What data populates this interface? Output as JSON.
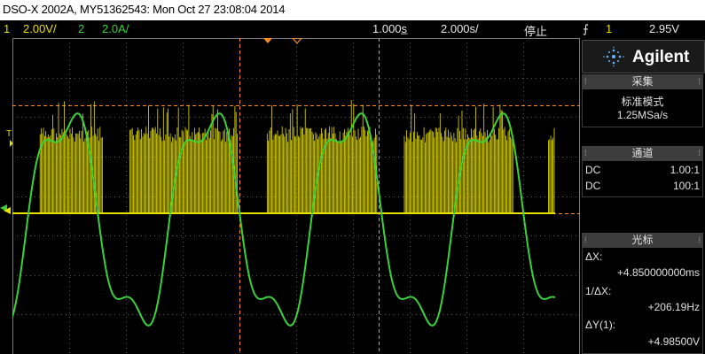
{
  "title_bar": {
    "text": "DSO-X 2002A, MY51362543: Mon Oct 27 23:08:04 2014"
  },
  "status_bar": {
    "ch1_num": "1",
    "ch1_scale": "2.00V/",
    "ch2_num": "2",
    "ch2_scale": "2.0A/",
    "delay": "1.000s̲",
    "timebase": "2.000s/",
    "run_state": "停止",
    "trigger_slope": "⨍",
    "trigger_source": "1",
    "trigger_level": "2.95V"
  },
  "panel": {
    "brand": "Agilent",
    "acquire": {
      "header": "采集",
      "mode": "标准模式",
      "rate": "1.25MSa/s"
    },
    "channels": {
      "header": "通道",
      "rows": [
        {
          "coupling": "DC",
          "ratio": "1.00:1",
          "color": "#e8e000"
        },
        {
          "coupling": "DC",
          "ratio": "100:1",
          "color": "#3bd13b"
        }
      ]
    },
    "cursors": {
      "header": "光标",
      "dx_label": "ΔX:",
      "dx_value": "+4.850000000ms",
      "inv_dx_label": "1/ΔX:",
      "inv_dx_value": "+206.19Hz",
      "dy_label": "ΔY(1):",
      "dy_value": "+4.98500V"
    }
  },
  "colors": {
    "ch1": "#e8e000",
    "ch2": "#3bd13b",
    "cursor": "#ff8c1a",
    "grid": "#5a5a5a"
  }
}
